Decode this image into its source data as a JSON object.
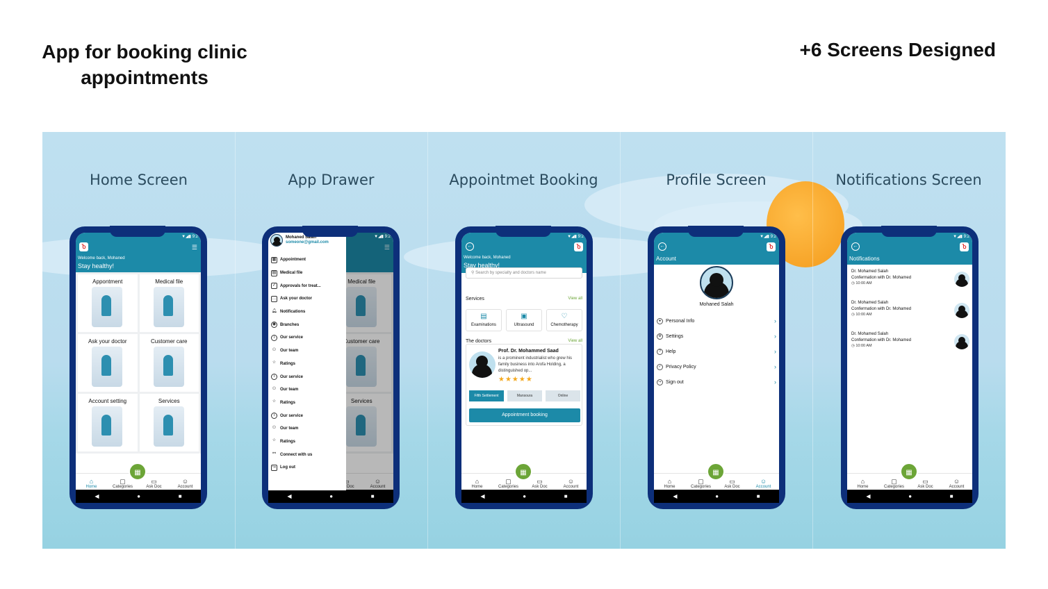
{
  "heading": {
    "title": "App for booking clinic appointments",
    "screens_count": "+6 Screens Designed"
  },
  "colors": {
    "brand": "#1c8aa8",
    "fab": "#6ca537",
    "phone_frame": "#0d2f7a",
    "sun": "#f49b1c"
  },
  "sections": [
    "Home Screen",
    "App Drawer",
    "Appointmet Booking",
    "Profile Screen",
    "Notifications Screen"
  ],
  "status_bar": "▼◢▮ 9:2",
  "tabbar": [
    {
      "label": "Home",
      "icon": "home-icon",
      "glyph": "⌂"
    },
    {
      "label": "Categories",
      "icon": "bag-icon",
      "glyph": "▢"
    },
    {
      "label": "Ask Doc",
      "icon": "chat-icon",
      "glyph": "▭"
    },
    {
      "label": "Account",
      "icon": "user-icon",
      "glyph": "☺"
    }
  ],
  "home": {
    "welcome": "Welcome back, Mohaned",
    "tagline": "Stay healthy!",
    "cards": [
      "Appontment",
      "Medical file",
      "Ask your doctor",
      "Customer care",
      "Account setting",
      "Services"
    ]
  },
  "drawer": {
    "name": "Mohaned Salah",
    "email": "someone@gmail.com",
    "items": [
      "Appointment",
      "Medical file",
      "Approvals for treat...",
      "Ask your doctor",
      "Notifications",
      "Branches",
      "Our service",
      "Our team",
      "Ratings",
      "Our service",
      "Our team",
      "Ratings",
      "Our service",
      "Our team",
      "Ratings",
      "Connect with us",
      "Log out"
    ]
  },
  "booking": {
    "welcome": "Welcome back, Mohaned",
    "tagline": "Stay healthy!",
    "search_placeholder": "Search by specialty and doctors name",
    "services_label": "Services",
    "view_all": "View all",
    "services": [
      "Examinations",
      "Ultrasound",
      "Chemotherapy"
    ],
    "doctors_label": "The doctors",
    "doctor": {
      "name": "Prof. Dr. Mohammed Saad",
      "bio": "is a prominent industrialist who grew his family business into Arofa Holding, a distinguished op...",
      "rating": "★★★★★",
      "locations": [
        "Fifth Settlement",
        "Mansoura",
        "Online"
      ]
    },
    "book_button": "Appointment booking"
  },
  "profile": {
    "title": "Account",
    "name": "Mohaned Salah",
    "items": [
      "Personal Info",
      "Settings",
      "Help",
      "Privacy Policy",
      "Sign out"
    ]
  },
  "notifications": {
    "title": "Notifications",
    "items": [
      {
        "name": "Dr. Mohamed Salah",
        "text": "Confermation with Dr. Mohamed",
        "time": "10:00 AM"
      },
      {
        "name": "Dr. Mohamed Salah",
        "text": "Confermation with Dr. Mohamed",
        "time": "10:00 AM"
      },
      {
        "name": "Dr. Mohamed Salah",
        "text": "Confermation with Dr. Mohamed",
        "time": "10:00 AM"
      }
    ]
  }
}
